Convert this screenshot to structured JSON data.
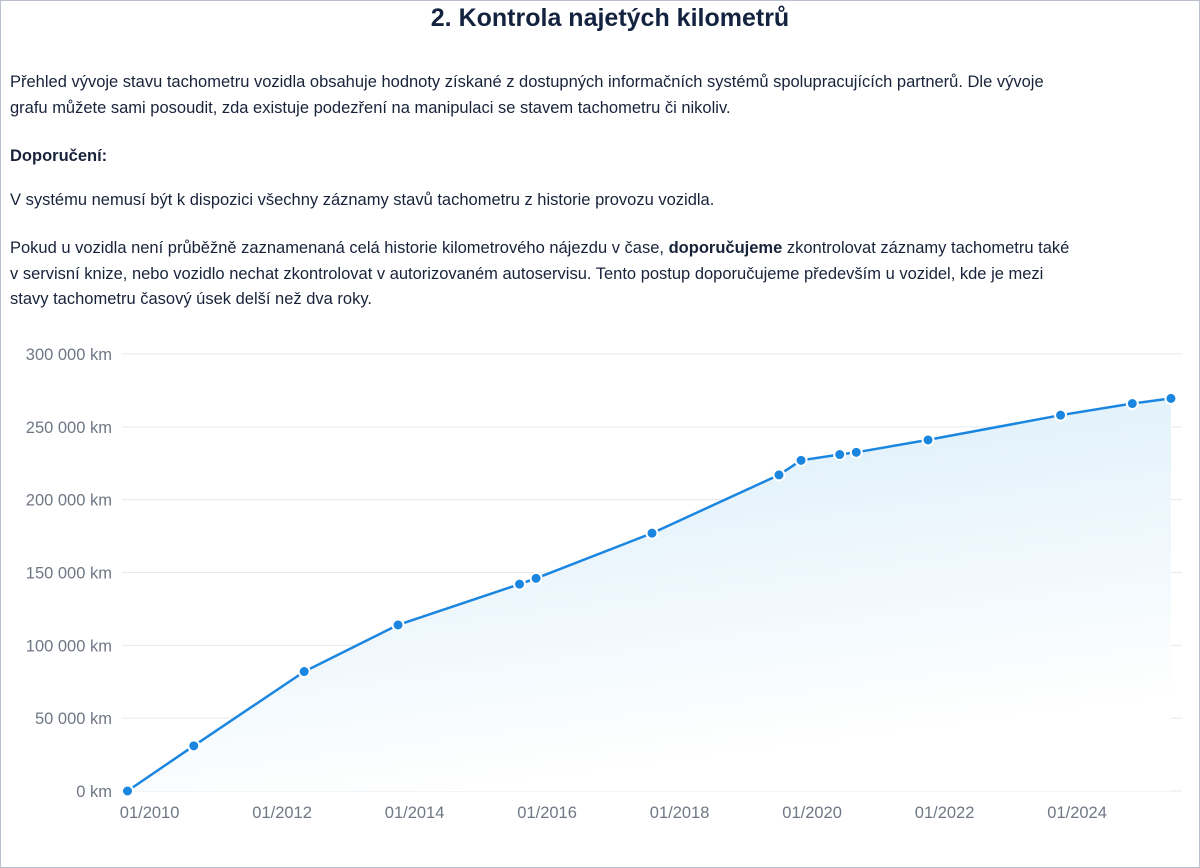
{
  "heading": "2. Kontrola najetých kilometrů",
  "intro": {
    "line1": "Přehled vývoje stavu tachometru vozidla obsahuje hodnoty získané z dostupných informačních systémů spolupracujících partnerů. Dle vývoje",
    "line2": "grafu můžete sami posoudit, zda existuje podezření na manipulaci se stavem tachometru či nikoliv."
  },
  "recommendation_label": "Doporučení:",
  "note1": "V systému nemusí být k dispozici všechny záznamy stavů tachometru z historie provozu vozidla.",
  "note2": {
    "line1_before": "Pokud u vozidla není průběžně zaznamenaná celá historie kilometrového nájezdu v čase, ",
    "line1_bold": "doporučujeme",
    "line1_after": " zkontrolovat záznamy tachometru také",
    "line2": "v servisní knize, nebo vozidlo nechat zkontrolovat v autorizovaném autoservisu. Tento postup doporučujeme především u vozidel, kde je mezi",
    "line3": "stavy tachometru časový úsek delší než dva roky."
  },
  "colors": {
    "line": "#1a86e0",
    "point": "#1a86e0",
    "area_top": "#d6ecf9",
    "grid": "#e6e9ee"
  },
  "chart_data": {
    "type": "area",
    "ylim": [
      0,
      300000
    ],
    "y_ticks": [
      0,
      50000,
      100000,
      150000,
      200000,
      250000,
      300000
    ],
    "y_tick_labels": [
      "0 km",
      "50 000 km",
      "100 000 km",
      "150 000 km",
      "200 000 km",
      "250 000 km",
      "300 000 km"
    ],
    "x_ticks": [
      "2010-01",
      "2012-01",
      "2014-01",
      "2016-01",
      "2018-01",
      "2020-01",
      "2022-01",
      "2024-01"
    ],
    "x_tick_labels": [
      "01/2010",
      "01/2012",
      "01/2014",
      "01/2016",
      "01/2018",
      "01/2020",
      "01/2022",
      "01/2024"
    ],
    "xlim": [
      "2009-08",
      "2025-08"
    ],
    "grid": true,
    "points": [
      {
        "x": "2009-09",
        "y": 0
      },
      {
        "x": "2010-09",
        "y": 31000
      },
      {
        "x": "2012-05",
        "y": 82000
      },
      {
        "x": "2013-10",
        "y": 114000
      },
      {
        "x": "2015-08",
        "y": 142000
      },
      {
        "x": "2015-11",
        "y": 146000
      },
      {
        "x": "2017-08",
        "y": 177000
      },
      {
        "x": "2019-07",
        "y": 217000
      },
      {
        "x": "2019-11",
        "y": 227000
      },
      {
        "x": "2020-06",
        "y": 231000
      },
      {
        "x": "2020-09",
        "y": 232500
      },
      {
        "x": "2021-10",
        "y": 241000
      },
      {
        "x": "2023-10",
        "y": 258000
      },
      {
        "x": "2024-11",
        "y": 266000
      },
      {
        "x": "2025-06",
        "y": 269500
      }
    ]
  }
}
